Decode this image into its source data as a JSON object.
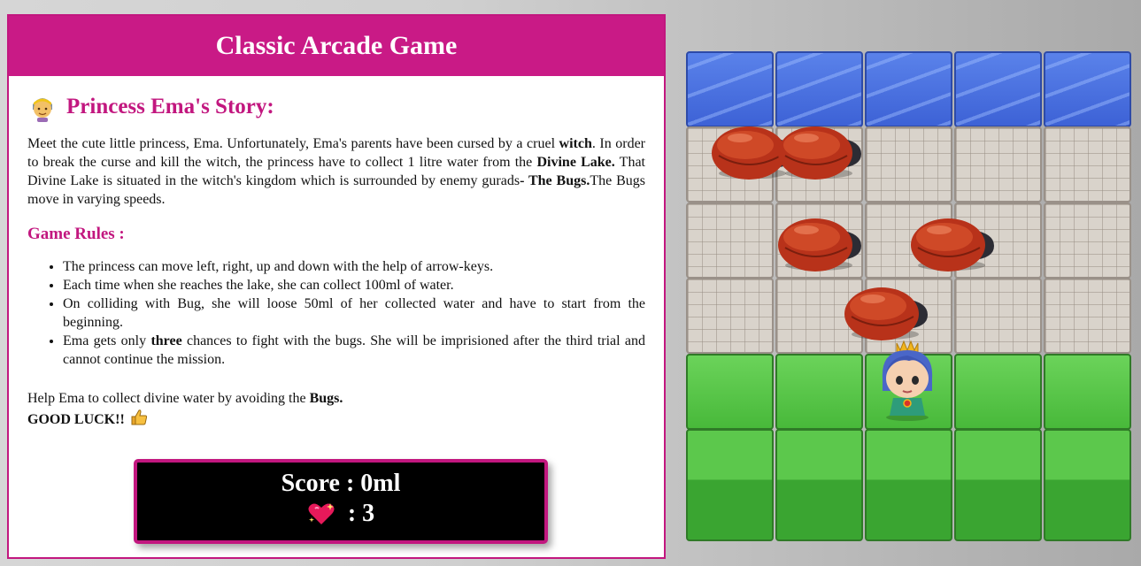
{
  "header": {
    "title": "Classic Arcade Game"
  },
  "story": {
    "icon": "princess-icon",
    "title": "Princess Ema's Story:",
    "p1": "Meet the cute little princess, Ema. Unfortunately, Ema's parents have been cursed by a cruel ",
    "p1_bold1": "witch",
    "p1_b": ". In order to break the curse and kill the witch, the princess have to collect 1 litre water from the ",
    "p1_bold2": "Divine Lake.",
    "p1_c": " That Divine Lake is situated in the witch's kingdom which is surrounded by enemy gurads",
    "p1_bold3": "- The Bugs.",
    "p1_d": "The Bugs move in varying speeds."
  },
  "rules": {
    "title": "Game Rules :",
    "items": [
      "The princess can move left, right, up and down with the help of arrow-keys.",
      "Each time when she reaches the lake, she can collect 100ml of water.",
      "On colliding with Bug, she will loose 50ml of her collected water and have to start from the beginning."
    ],
    "item4_a": "Ema gets only ",
    "item4_bold": "three",
    "item4_b": " chances to fight with the bugs. She will be imprisioned after the third trial and cannot continue the mission."
  },
  "help": {
    "text": "Help Ema to collect divine water by avoiding the ",
    "bold": "Bugs.",
    "luck": "GOOD LUCK!!",
    "luck_icon": "thumbs-up-icon"
  },
  "scoreboard": {
    "score_label": "Score : 0ml",
    "lives_icon": "sparkling-heart-icon",
    "lives": ": 3"
  },
  "board": {
    "rows": [
      "water",
      "stone",
      "stone",
      "stone",
      "grass",
      "grass"
    ],
    "columns": 5,
    "enemies": 5,
    "player": "princess-sprite",
    "colors": {
      "accent": "#c91a86",
      "water": "#4a70e0",
      "grass": "#5cc84c",
      "bug": "#c23a1c"
    }
  }
}
